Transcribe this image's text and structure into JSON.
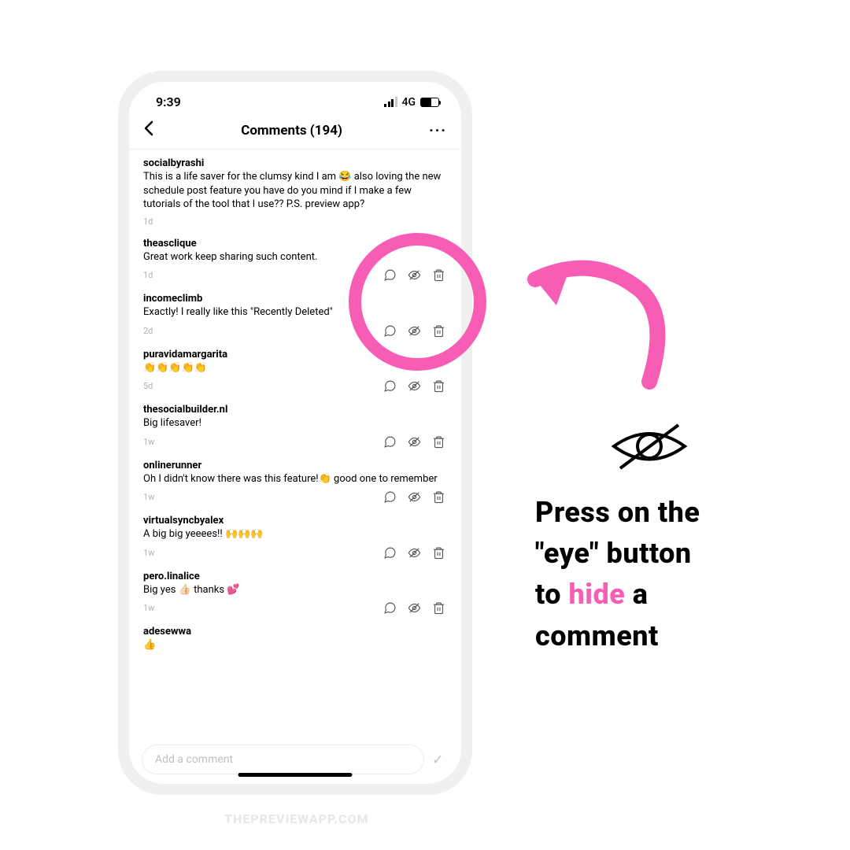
{
  "status": {
    "time": "9:39",
    "network": "4G"
  },
  "nav": {
    "title": "Comments (194)"
  },
  "comments": [
    {
      "user": "socialbyrashi",
      "body": "This is a life saver for the clumsy kind I am 😂 also loving the new schedule post feature you have do you mind if I make a few tutorials of the tool that I use?? P.S. preview app?",
      "time": "1d",
      "actions": false
    },
    {
      "user": "theasclique",
      "body": "Great work keep sharing such content.",
      "time": "1d",
      "actions": true
    },
    {
      "user": "incomeclimb",
      "body": "Exactly! I really like this \"Recently Deleted\"",
      "time": "2d",
      "actions": true
    },
    {
      "user": "puravidamargarita",
      "body": "👏👏👏👏👏",
      "time": "5d",
      "actions": true
    },
    {
      "user": "thesocialbuilder.nl",
      "body": "Big lifesaver!",
      "time": "1w",
      "actions": true
    },
    {
      "user": "onlinerunner",
      "body": "Oh I didn't know there was this feature!👏 good one to remember",
      "time": "1w",
      "actions": true
    },
    {
      "user": "virtualsyncbyalex",
      "body": "A big big yeeees!! 🙌🙌🙌",
      "time": "1w",
      "actions": true
    },
    {
      "user": "pero.linalice",
      "body": "Big yes 👍🏻 thanks 💕",
      "time": "1w",
      "actions": true
    },
    {
      "user": "adesewwa",
      "body": "👍",
      "time": "",
      "actions": false
    }
  ],
  "compose": {
    "placeholder": "Add a comment"
  },
  "annotation": {
    "line1": "Press on the",
    "line2a": "\"eye\" button",
    "line3a": "to ",
    "hide": "hide",
    "line3b": " a",
    "line4": "comment"
  },
  "watermark": "THEPREVIEWAPP.COM"
}
